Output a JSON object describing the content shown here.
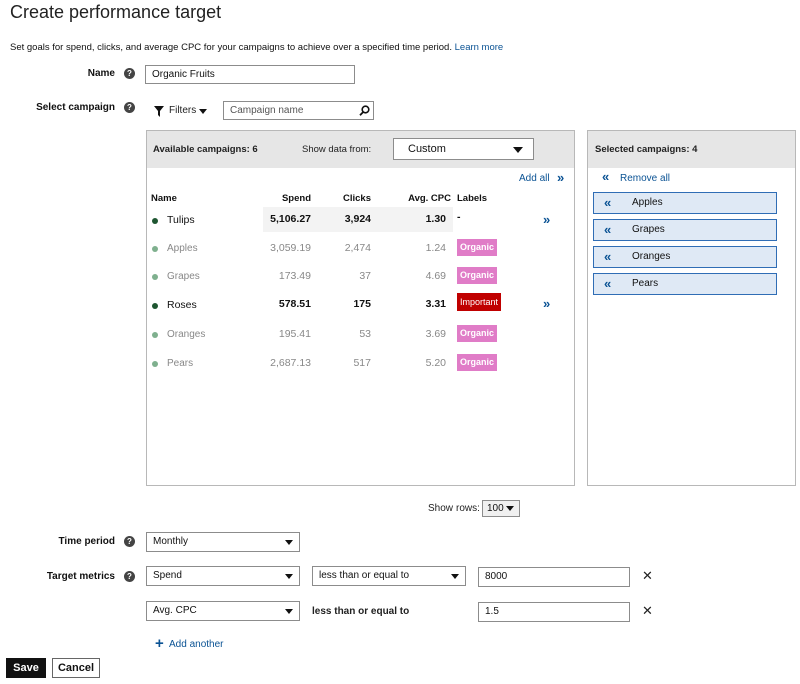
{
  "page": {
    "title": "Create performance target",
    "description": "Set goals for spend, clicks, and average CPC for your campaigns to achieve over a specified time period.",
    "learn_more": "Learn more"
  },
  "form": {
    "name_label": "Name",
    "name_value": "Organic Fruits",
    "select_campaign_label": "Select campaign",
    "filters_label": "Filters",
    "campaign_search_placeholder": "Campaign name",
    "time_period_label": "Time period",
    "time_period_value": "Monthly",
    "target_metrics_label": "Target metrics",
    "metrics": [
      {
        "metric": "Spend",
        "operator": "less than or equal to",
        "value": "8000"
      },
      {
        "metric": "Avg. CPC",
        "operator": "less than or equal to",
        "value": "1.5"
      }
    ],
    "add_another": "Add another"
  },
  "available": {
    "header": "Available campaigns: 6",
    "show_data_from_label": "Show data from:",
    "show_data_from_value": "Custom",
    "add_all": "Add all",
    "columns": [
      "Name",
      "Spend",
      "Clicks",
      "Avg. CPC",
      "Labels"
    ],
    "rows": [
      {
        "name": "Tulips",
        "spend": "5,106.27",
        "clicks": "3,924",
        "cpc": "1.30",
        "label": "-",
        "active": true
      },
      {
        "name": "Apples",
        "spend": "3,059.19",
        "clicks": "2,474",
        "cpc": "1.24",
        "label": "Organic",
        "active": false
      },
      {
        "name": "Grapes",
        "spend": "173.49",
        "clicks": "37",
        "cpc": "4.69",
        "label": "Organic",
        "active": false
      },
      {
        "name": "Roses",
        "spend": "578.51",
        "clicks": "175",
        "cpc": "3.31",
        "label": "Important",
        "active": true
      },
      {
        "name": "Oranges",
        "spend": "195.41",
        "clicks": "53",
        "cpc": "3.69",
        "label": "Organic",
        "active": false
      },
      {
        "name": "Pears",
        "spend": "2,687.13",
        "clicks": "517",
        "cpc": "5.20",
        "label": "Organic",
        "active": false
      }
    ],
    "show_rows_label": "Show",
    "rows_label": "rows:",
    "rows_value": "100"
  },
  "selected": {
    "header": "Selected campaigns: 4",
    "remove_all": "Remove all",
    "items": [
      "Apples",
      "Grapes",
      "Oranges",
      "Pears"
    ]
  },
  "buttons": {
    "save": "Save",
    "cancel": "Cancel"
  },
  "colors": {
    "accent_blue": "#0b5394",
    "organic_badge": "#e07cc7",
    "important_badge": "#c00000",
    "active_dot": "#1e5631",
    "muted_dot": "#7fb08e"
  }
}
